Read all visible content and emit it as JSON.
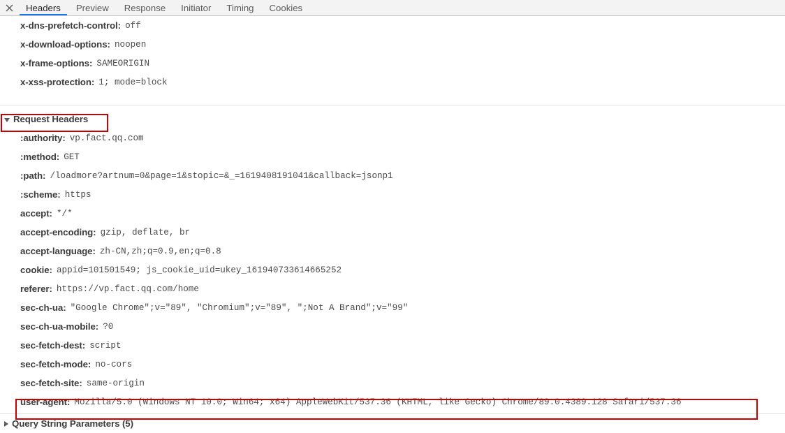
{
  "tabbar": {
    "close_icon": "close-icon",
    "tabs": [
      {
        "label": "Headers",
        "active": true
      },
      {
        "label": "Preview",
        "active": false
      },
      {
        "label": "Response",
        "active": false
      },
      {
        "label": "Initiator",
        "active": false
      },
      {
        "label": "Timing",
        "active": false
      },
      {
        "label": "Cookies",
        "active": false
      }
    ]
  },
  "response_headers_tail": [
    {
      "name": "x-dns-prefetch-control",
      "value": "off"
    },
    {
      "name": "x-download-options",
      "value": "noopen"
    },
    {
      "name": "x-frame-options",
      "value": "SAMEORIGIN"
    },
    {
      "name": "x-xss-protection",
      "value": "1; mode=block"
    }
  ],
  "request_headers_section": {
    "title": "Request Headers",
    "expanded": true,
    "triangle": "triangle-down-icon",
    "highlighted": true,
    "items": [
      {
        "name": ":authority",
        "value": "vp.fact.qq.com"
      },
      {
        "name": ":method",
        "value": "GET"
      },
      {
        "name": ":path",
        "value": "/loadmore?artnum=0&page=1&stopic=&_=1619408191041&callback=jsonp1"
      },
      {
        "name": ":scheme",
        "value": "https"
      },
      {
        "name": "accept",
        "value": "*/*"
      },
      {
        "name": "accept-encoding",
        "value": "gzip, deflate, br"
      },
      {
        "name": "accept-language",
        "value": "zh-CN,zh;q=0.9,en;q=0.8"
      },
      {
        "name": "cookie",
        "value": "appid=101501549; js_cookie_uid=ukey_161940733614665252"
      },
      {
        "name": "referer",
        "value": "https://vp.fact.qq.com/home"
      },
      {
        "name": "sec-ch-ua",
        "value": "\"Google Chrome\";v=\"89\", \"Chromium\";v=\"89\", \";Not A Brand\";v=\"99\""
      },
      {
        "name": "sec-ch-ua-mobile",
        "value": "?0"
      },
      {
        "name": "sec-fetch-dest",
        "value": "script"
      },
      {
        "name": "sec-fetch-mode",
        "value": "no-cors"
      },
      {
        "name": "sec-fetch-site",
        "value": "same-origin"
      },
      {
        "name": "user-agent",
        "value": "Mozilla/5.0 (Windows NT 10.0; Win64; x64) AppleWebKit/537.36 (KHTML, like Gecko) Chrome/89.0.4389.128 Safari/537.36",
        "highlighted": true
      }
    ]
  },
  "query_string_section": {
    "title": "Query String Parameters (5)",
    "expanded": false,
    "triangle": "triangle-right-icon"
  },
  "colors": {
    "accent_tab_underline": "#1a73e8",
    "annotation_box": "#cc0000",
    "tabbar_background": "#f3f3f3",
    "header_name_text": "#3c3c3c",
    "header_value_text": "#4a4a4a"
  }
}
